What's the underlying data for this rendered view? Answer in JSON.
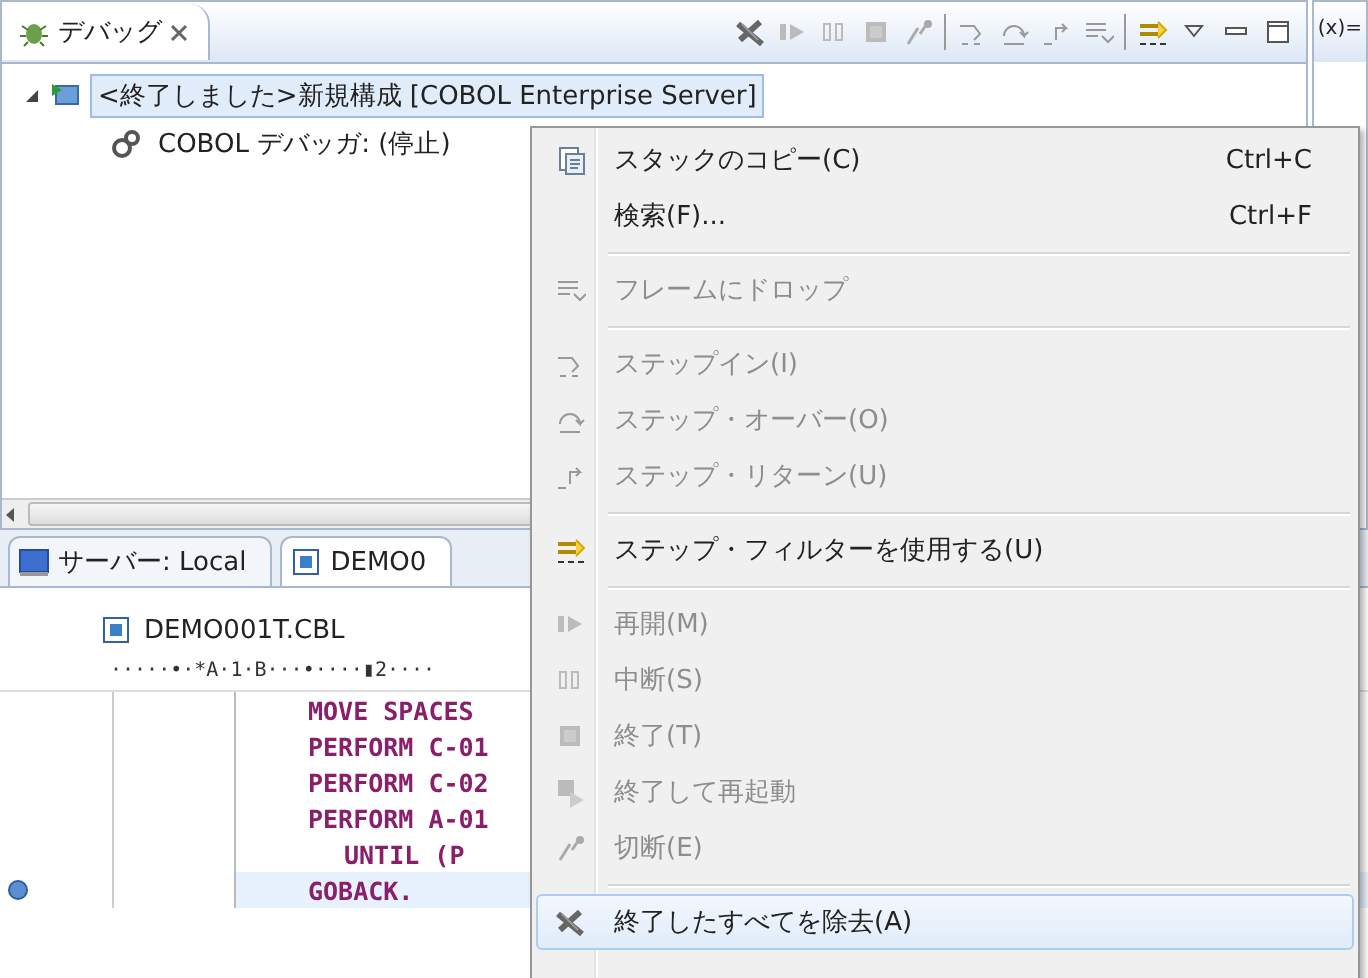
{
  "debug_view": {
    "tab": {
      "label": "デバッグ",
      "selected": true
    },
    "tree": [
      {
        "label": "<終了しました>新規構成 [COBOL Enterprise Server]",
        "selected": true,
        "expanded": true,
        "children": [
          {
            "label": "COBOL デバッガ: (停止)",
            "selected": false
          }
        ]
      }
    ]
  },
  "variables_view": {
    "tab": {
      "label": "(x)="
    }
  },
  "bottom_tabs": [
    {
      "label": "サーバー: Local",
      "selected": false
    },
    {
      "label": "DEMO0",
      "selected": true
    }
  ],
  "editor": {
    "file": "DEMO001T.CBL",
    "ruler": "·····•·*A·1·B···•····▮2····",
    "lines": [
      {
        "keyword": "MOVE",
        "text": " SPACES",
        "current": false,
        "breakpoint": false
      },
      {
        "keyword": "PERFORM",
        "text": " C-01",
        "current": false,
        "breakpoint": false
      },
      {
        "keyword": "PERFORM",
        "text": " C-02",
        "current": false,
        "breakpoint": false
      },
      {
        "keyword": "PERFORM",
        "text": " A-01",
        "current": false,
        "breakpoint": false,
        "children": [
          {
            "keyword": "UNTIL",
            "text": " (P",
            "current": false,
            "breakpoint": false
          }
        ]
      },
      {
        "keyword": "GOBACK",
        "text": ".",
        "current": true,
        "breakpoint": true
      }
    ]
  },
  "context_menu": {
    "groups": [
      [
        {
          "label": "スタックのコピー(C)",
          "shortcut": "Ctrl+C",
          "disabled": false,
          "selected": false
        },
        {
          "label": "検索(F)...",
          "shortcut": "Ctrl+F",
          "disabled": false,
          "selected": false
        }
      ],
      [
        {
          "label": "フレームにドロップ",
          "disabled": true,
          "selected": false
        }
      ],
      [
        {
          "label": "ステップイン(I)",
          "disabled": true,
          "selected": false
        },
        {
          "label": "ステップ・オーバー(O)",
          "disabled": true,
          "selected": false
        },
        {
          "label": "ステップ・リターン(U)",
          "disabled": true,
          "selected": false
        }
      ],
      [
        {
          "label": "ステップ・フィルターを使用する(U)",
          "disabled": false,
          "selected": false
        }
      ],
      [
        {
          "label": "再開(M)",
          "disabled": true,
          "selected": false
        },
        {
          "label": "中断(S)",
          "disabled": true,
          "selected": false
        },
        {
          "label": "終了(T)",
          "disabled": true,
          "selected": false
        },
        {
          "label": "終了して再起動",
          "disabled": true,
          "selected": false
        },
        {
          "label": "切断(E)",
          "disabled": true,
          "selected": false
        }
      ],
      [
        {
          "label": "終了したすべてを除去(A)",
          "disabled": false,
          "selected": true
        }
      ]
    ]
  }
}
